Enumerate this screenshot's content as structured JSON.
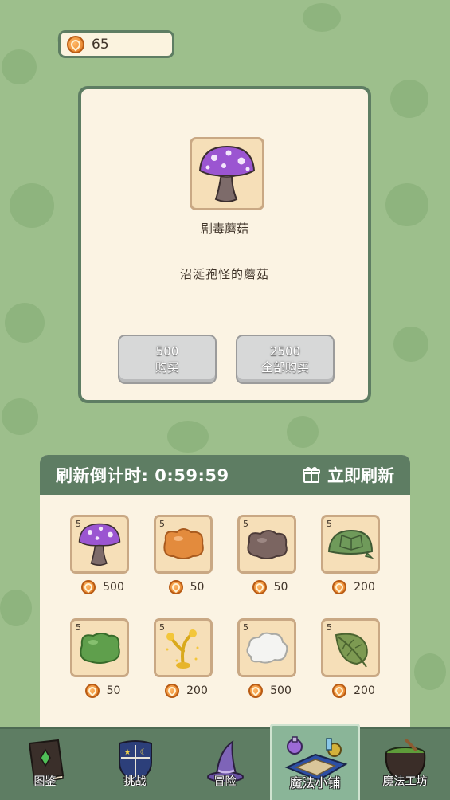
{
  "currency": {
    "icon": "coin-icon",
    "amount": "65"
  },
  "detail": {
    "item_icon": "purple-mushroom-icon",
    "name": "剧毒蘑菇",
    "description": "沼涎孢怪的蘑菇",
    "buy_one": {
      "price": "500",
      "label": "购买"
    },
    "buy_all": {
      "price": "2500",
      "label": "全部购买"
    }
  },
  "shop": {
    "timer_label": "刷新倒计时: 0:59:59",
    "refresh_label": "立即刷新",
    "refresh_icon": "gift-icon",
    "items": [
      {
        "icon": "purple-mushroom-icon",
        "qty": "5",
        "price": "500"
      },
      {
        "icon": "orange-slime-icon",
        "qty": "5",
        "price": "50"
      },
      {
        "icon": "brown-mud-icon",
        "qty": "5",
        "price": "50"
      },
      {
        "icon": "turtle-shell-icon",
        "qty": "5",
        "price": "200"
      },
      {
        "icon": "green-slime-icon",
        "qty": "5",
        "price": "50"
      },
      {
        "icon": "golden-sprout-icon",
        "qty": "5",
        "price": "200"
      },
      {
        "icon": "white-cloud-icon",
        "qty": "5",
        "price": "500"
      },
      {
        "icon": "green-leaf-icon",
        "qty": "5",
        "price": "200"
      }
    ]
  },
  "nav": [
    {
      "label": "图鉴",
      "icon": "book-icon",
      "active": false
    },
    {
      "label": "挑战",
      "icon": "shield-icon",
      "active": false
    },
    {
      "label": "冒险",
      "icon": "wizard-hat-icon",
      "active": false
    },
    {
      "label": "魔法小铺",
      "icon": "magic-shop-icon",
      "active": true
    },
    {
      "label": "魔法工坊",
      "icon": "cauldron-icon",
      "active": false
    }
  ],
  "colors": {
    "background": "#9dbf8c",
    "panel": "#fbf3e3",
    "accent": "#5e7d63",
    "slot": "#f6dfb8",
    "button_disabled": "#d7d8d8"
  }
}
